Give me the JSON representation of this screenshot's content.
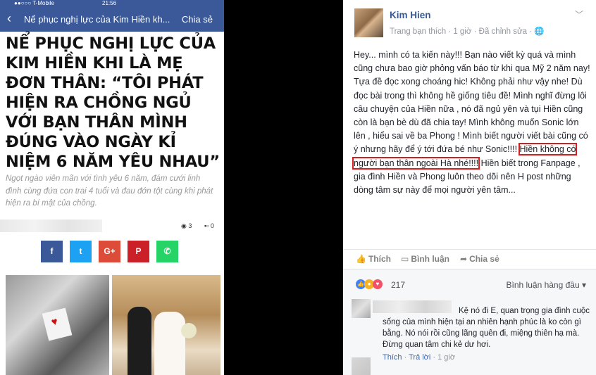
{
  "phone": {
    "status": {
      "carrier": "●●○○○ T-Mobile",
      "time": "21:56"
    },
    "nav": {
      "back_glyph": "‹",
      "title": "Nể phục nghị lực của Kim Hiền kh...",
      "share": "Chia sẻ"
    },
    "article": {
      "title": "NỂ PHỤC NGHỊ LỰC CỦA KIM HIỀN KHI LÀ MẸ ĐƠN THÂN: “TÔI PHÁT HIỆN RA CHỒNG NGỦ VỚI BẠN THÂN MÌNH ĐÚNG VÀO NGÀY KỈ NIỆM 6 NĂM YÊU NHAU”",
      "sapo": "Ngọt ngào viên mãn với tình yêu 6 năm, đám cưới linh đình cùng đứa con trai 4 tuổi và đau đớn tột cùng khi phát hiện ra bí mật của chồng.",
      "views": "3",
      "comments": "0"
    },
    "share_buttons": [
      {
        "label": "f",
        "color": "#3b5998"
      },
      {
        "label": "t",
        "color": "#1da1f2"
      },
      {
        "label": "G+",
        "color": "#dd4b39"
      },
      {
        "label": "P",
        "color": "#cb2027"
      },
      {
        "label": "✆",
        "color": "#25d366"
      }
    ]
  },
  "post": {
    "author": "Kim Hien",
    "meta": "Trang bạn thích · 1 giờ · Đã chỉnh sửa · 🌐",
    "body_lines": {
      "before": "Hey... mình có ta kiến này!!! Bạn nào viết kỳ quá và mình cũng chưa bao giờ phỏng vấn báo từ khi qua Mỹ 2 năm nay! Tựa đề đọc xong choáng hic! Không phải như vậy nhe! Dù đọc bài trong thì không hề giống tiêu đề! Mình nghĩ đừng lôi câu chuyện của Hiền nữa , nó đã ngủ yên và tụi Hiền cũng còn là bạn bè dù đã chia tay! Mình không muốn Sonic lớn lên , hiểu sai về ba Phong ! Mình biết người viết bài cũng có ý nhưng hãy để ý tới đứa bé như Sonic!!!!",
      "highlight": "Hiền không có người bạn thân ngoài Hà nhé!!!!",
      "after": "Hiền biết trong Fanpage , gia đình Hiền và Phong luôn theo dõi nên H post những dòng tâm sự này để mọi người yên tâm..."
    },
    "actions": {
      "like": "Thích",
      "comment": "Bình luận",
      "share": "Chia sẻ"
    },
    "reactions_count": "217",
    "sort_label": "Bình luận hàng đầu",
    "comment": {
      "text": "Kệ nó đi E, quan trọng gia đình cuộc sống của mình hiện tại an nhiên hạnh phúc là ko còn gì bằng. Nó nói rồi cũng lãng quên đi, miệng thiên hạ mà. Đừng quan tâm chi kẻ dư hơi.",
      "like": "Thích",
      "reply": "Trả lời",
      "time": "1 giờ"
    }
  }
}
